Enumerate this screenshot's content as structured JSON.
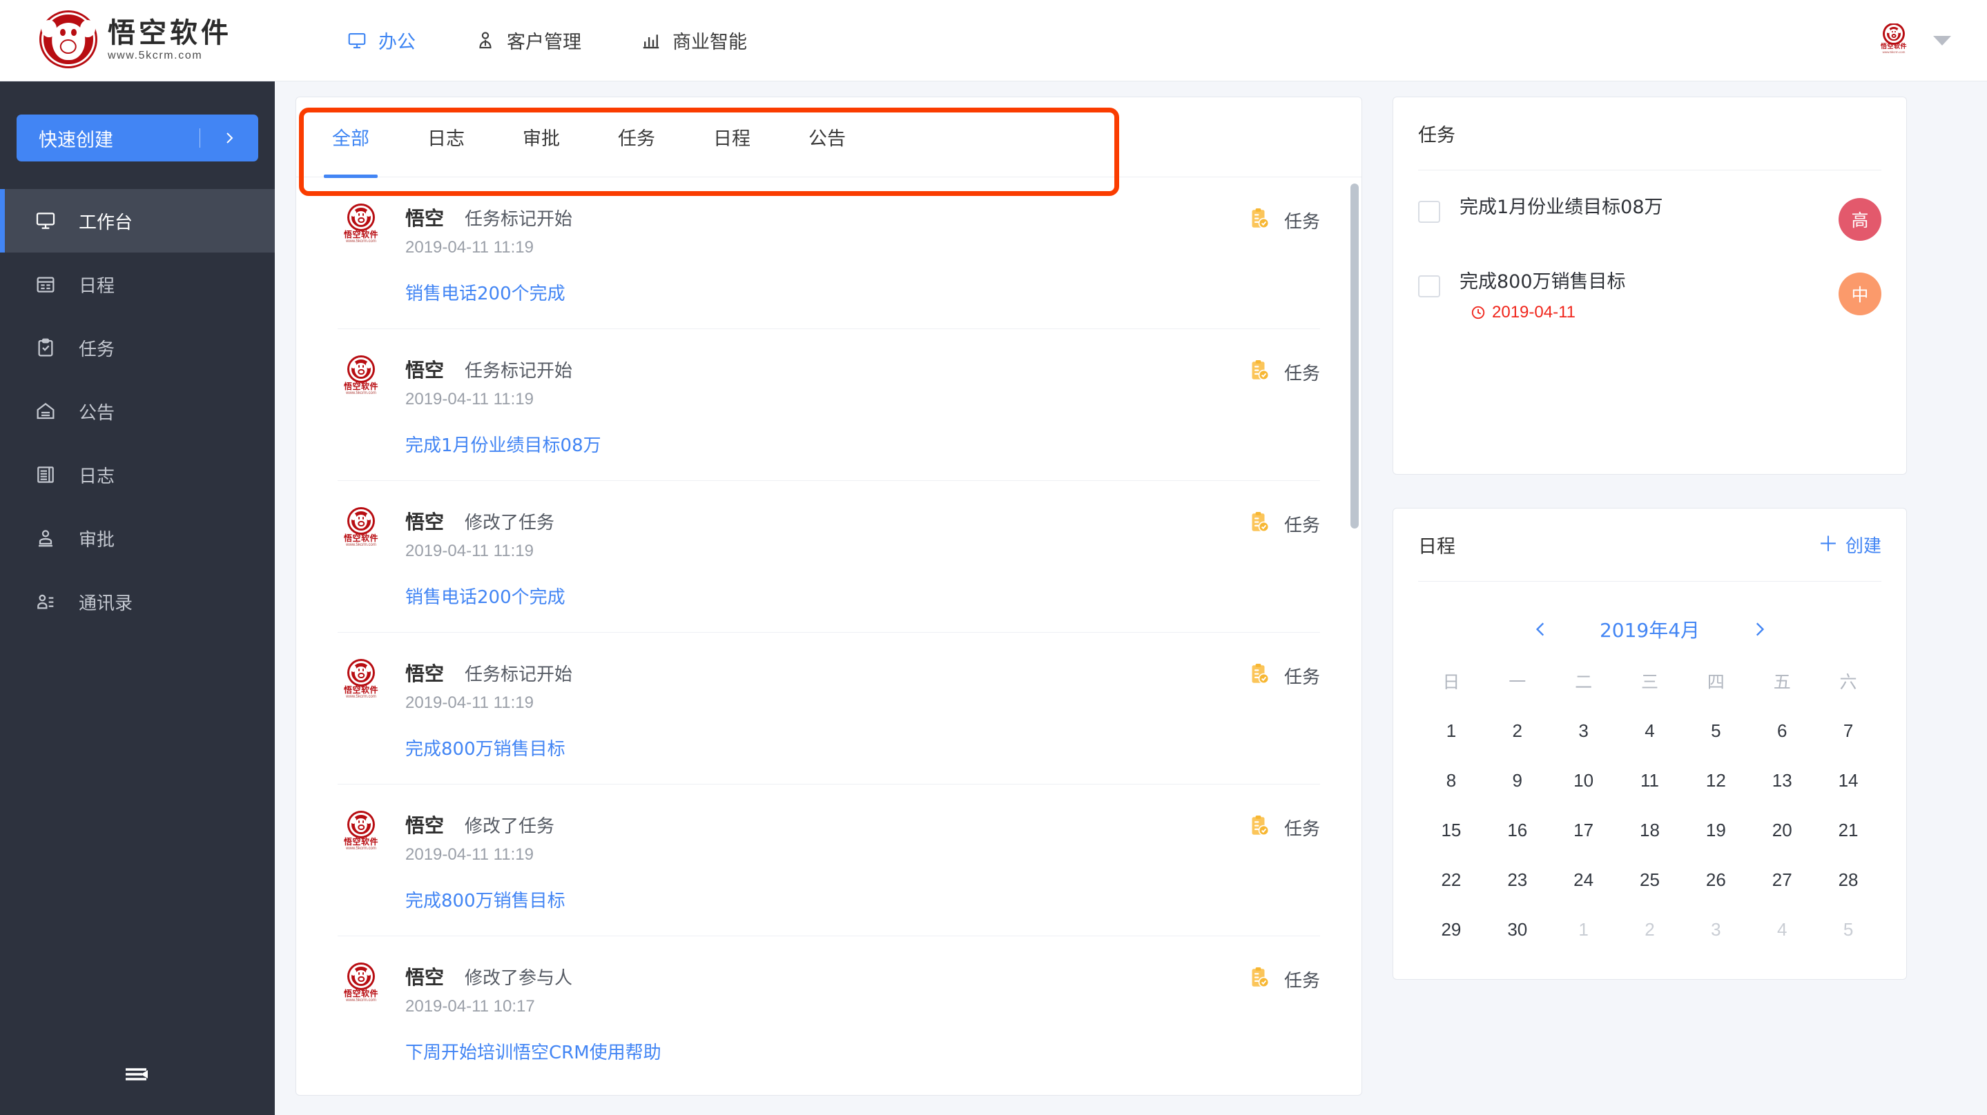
{
  "brand": {
    "name": "悟空软件",
    "url": "www.5kcrm.com",
    "logo_color": "#b80d12"
  },
  "header": {
    "nav": [
      {
        "label": "办公",
        "icon": "monitor-icon",
        "active": true
      },
      {
        "label": "客户管理",
        "icon": "user-icon",
        "active": false
      },
      {
        "label": "商业智能",
        "icon": "bar-chart-icon",
        "active": false
      }
    ],
    "avatar_alt": "悟空软件",
    "dropdown_icon": "chevron-down-icon"
  },
  "sidebar": {
    "quick_create": {
      "label": "快速创建",
      "chevron_icon": "chevron-right-icon"
    },
    "items": [
      {
        "label": "工作台",
        "icon": "monitor-icon",
        "active": true
      },
      {
        "label": "日程",
        "icon": "calendar-icon",
        "active": false
      },
      {
        "label": "任务",
        "icon": "clipboard-check-icon",
        "active": false
      },
      {
        "label": "公告",
        "icon": "announcement-icon",
        "active": false
      },
      {
        "label": "日志",
        "icon": "book-icon",
        "active": false
      },
      {
        "label": "审批",
        "icon": "stamp-icon",
        "active": false
      },
      {
        "label": "通讯录",
        "icon": "contacts-icon",
        "active": false
      }
    ],
    "collapse": {
      "icon": "collapse-sidebar-icon"
    }
  },
  "feed": {
    "tabs": [
      {
        "label": "全部",
        "active": true
      },
      {
        "label": "日志",
        "active": false
      },
      {
        "label": "审批",
        "active": false
      },
      {
        "label": "任务",
        "active": false
      },
      {
        "label": "日程",
        "active": false
      },
      {
        "label": "公告",
        "active": false
      }
    ],
    "items": [
      {
        "user": "悟空",
        "action": "任务标记开始",
        "time": "2019-04-11 11:19",
        "link": "销售电话200个完成",
        "type": "任务",
        "type_icon": "task-clipboard-icon"
      },
      {
        "user": "悟空",
        "action": "任务标记开始",
        "time": "2019-04-11 11:19",
        "link": "完成1月份业绩目标08万",
        "type": "任务",
        "type_icon": "task-clipboard-icon"
      },
      {
        "user": "悟空",
        "action": "修改了任务",
        "time": "2019-04-11 11:19",
        "link": "销售电话200个完成",
        "type": "任务",
        "type_icon": "task-clipboard-icon"
      },
      {
        "user": "悟空",
        "action": "任务标记开始",
        "time": "2019-04-11 11:19",
        "link": "完成800万销售目标",
        "type": "任务",
        "type_icon": "task-clipboard-icon"
      },
      {
        "user": "悟空",
        "action": "修改了任务",
        "time": "2019-04-11 11:19",
        "link": "完成800万销售目标",
        "type": "任务",
        "type_icon": "task-clipboard-icon"
      },
      {
        "user": "悟空",
        "action": "修改了参与人",
        "time": "2019-04-11 10:17",
        "link": "下周开始培训悟空CRM使用帮助",
        "type": "任务",
        "type_icon": "task-clipboard-icon"
      }
    ],
    "highlight_color": "#fa3c00"
  },
  "tasks_panel": {
    "title": "任务",
    "items": [
      {
        "name": "完成1月份业绩目标08万",
        "due": "",
        "priority": "高",
        "priority_color": "#e3596c",
        "checked": false
      },
      {
        "name": "完成800万销售目标",
        "due": "2019-04-11",
        "priority": "中",
        "priority_color": "#fb9a6b",
        "checked": false
      }
    ]
  },
  "calendar_panel": {
    "title": "日程",
    "create_label": "创建",
    "create_icon": "plus-icon",
    "prev_icon": "chevron-left-icon",
    "next_icon": "chevron-right-icon",
    "month": "2019年4月",
    "weekdays": [
      "日",
      "一",
      "二",
      "三",
      "四",
      "五",
      "六"
    ],
    "days": [
      {
        "n": "1",
        "muted": false
      },
      {
        "n": "2",
        "muted": false
      },
      {
        "n": "3",
        "muted": false
      },
      {
        "n": "4",
        "muted": false
      },
      {
        "n": "5",
        "muted": false
      },
      {
        "n": "6",
        "muted": false
      },
      {
        "n": "7",
        "muted": false
      },
      {
        "n": "8",
        "muted": false
      },
      {
        "n": "9",
        "muted": false
      },
      {
        "n": "10",
        "muted": false
      },
      {
        "n": "11",
        "muted": false
      },
      {
        "n": "12",
        "muted": false
      },
      {
        "n": "13",
        "muted": false
      },
      {
        "n": "14",
        "muted": false
      },
      {
        "n": "15",
        "muted": false
      },
      {
        "n": "16",
        "muted": false
      },
      {
        "n": "17",
        "muted": false
      },
      {
        "n": "18",
        "muted": false
      },
      {
        "n": "19",
        "muted": false
      },
      {
        "n": "20",
        "muted": false
      },
      {
        "n": "21",
        "muted": false
      },
      {
        "n": "22",
        "muted": false
      },
      {
        "n": "23",
        "muted": false
      },
      {
        "n": "24",
        "muted": false
      },
      {
        "n": "25",
        "muted": false
      },
      {
        "n": "26",
        "muted": false
      },
      {
        "n": "27",
        "muted": false
      },
      {
        "n": "28",
        "muted": false
      },
      {
        "n": "29",
        "muted": false
      },
      {
        "n": "30",
        "muted": false
      },
      {
        "n": "1",
        "muted": true
      },
      {
        "n": "2",
        "muted": true
      },
      {
        "n": "3",
        "muted": true
      },
      {
        "n": "4",
        "muted": true
      },
      {
        "n": "5",
        "muted": true
      }
    ]
  },
  "theme": {
    "accent": "#4285f4",
    "sidebar_bg": "#2d323e",
    "page_bg": "#f4f6fa"
  }
}
